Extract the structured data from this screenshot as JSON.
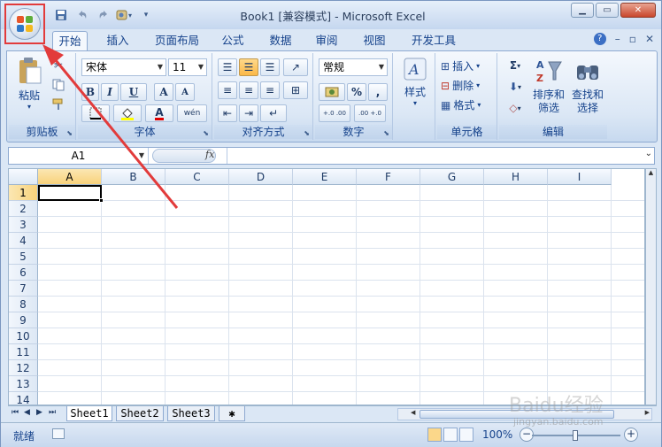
{
  "window": {
    "title": "Book1  [兼容模式] - Microsoft Excel",
    "controls": [
      "minimize-icon",
      "maximize-icon",
      "close-icon"
    ]
  },
  "quick_access": [
    "save-icon",
    "undo-icon",
    "redo-icon",
    "customize-icon"
  ],
  "tabs": [
    "开始",
    "插入",
    "页面布局",
    "公式",
    "数据",
    "审阅",
    "视图",
    "开发工具"
  ],
  "active_tab": "开始",
  "ribbon": {
    "clipboard": {
      "label": "剪贴板",
      "paste": "粘贴"
    },
    "font": {
      "label": "字体",
      "font_name": "宋体",
      "font_size": "11",
      "bold": "B",
      "italic": "I",
      "underline": "U",
      "grow": "A",
      "shrink": "A",
      "font_color": "A",
      "phonetic": "wén"
    },
    "alignment": {
      "label": "对齐方式"
    },
    "number": {
      "label": "数字",
      "format": "常规",
      "percent": "%",
      "comma": ",",
      "increase_dec": "+.0 .00",
      "decrease_dec": ".00 +.0"
    },
    "styles": {
      "label": "样式"
    },
    "cells": {
      "label": "单元格",
      "insert": "插入",
      "delete": "删除",
      "format": "格式"
    },
    "editing": {
      "label": "编辑",
      "sum": "Σ",
      "sort_filter": "排序和\n筛选",
      "find_select": "查找和\n选择",
      "sort_filter_line1": "排序和",
      "sort_filter_line2": "筛选",
      "find_select_line1": "查找和",
      "find_select_line2": "选择"
    }
  },
  "formula_bar": {
    "name_box": "A1",
    "fx": "fx",
    "value": ""
  },
  "sheet": {
    "columns": [
      "A",
      "B",
      "C",
      "D",
      "E",
      "F",
      "G",
      "H",
      "I"
    ],
    "rows": [
      "1",
      "2",
      "3",
      "4",
      "5",
      "6",
      "7",
      "8",
      "9",
      "10",
      "11",
      "12",
      "13",
      "14"
    ],
    "selected_cell": "A1"
  },
  "sheet_tabs": [
    "Sheet1",
    "Sheet2",
    "Sheet3"
  ],
  "active_sheet": "Sheet1",
  "status": {
    "text": "就绪",
    "zoom": "100%"
  },
  "watermark": {
    "brand": "Baidu经验",
    "url": "jingyan.baidu.com"
  },
  "colors": {
    "ribbon_bg": "#dbe7f5",
    "accent_highlight": "#e23b3b",
    "selected_header": "#f8d27b"
  }
}
